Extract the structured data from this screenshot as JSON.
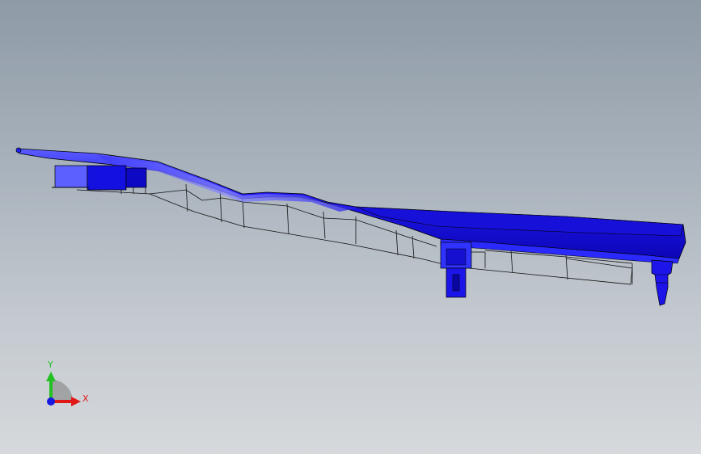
{
  "viewport": {
    "background_top": "#8e9aa6",
    "background_bottom": "#d6d9dc"
  },
  "model": {
    "body_color": "#1c14e8",
    "highlight_color": "#5a5cff",
    "edge_color": "#000000"
  },
  "triad": {
    "y_label": "Y",
    "x_label": "X",
    "y_color": "#22c022",
    "x_color": "#e01818",
    "z_color": "#1818e0"
  }
}
